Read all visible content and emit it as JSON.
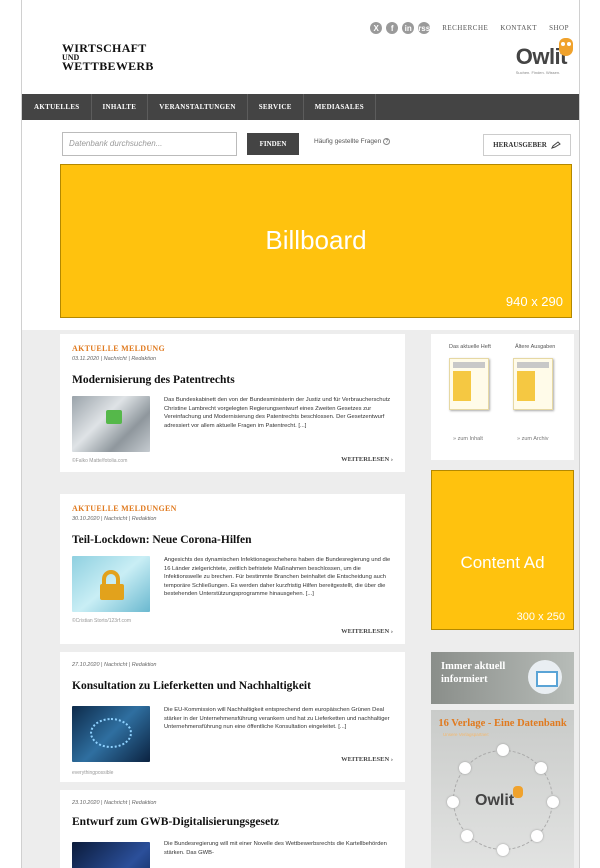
{
  "header": {
    "social_icons": [
      "X",
      "f",
      "in",
      "rss"
    ],
    "top_links": [
      "RECHERCHE",
      "KONTAKT",
      "SHOP"
    ],
    "logo": {
      "line1": "WIRTSCHAFT",
      "line2": "UND",
      "line3": "WETTBEWERB"
    },
    "owlit": {
      "name": "Owlit",
      "tagline": "Suchen. Finden. Wissen."
    }
  },
  "nav": {
    "items": [
      "AKTUELLES",
      "INHALTE",
      "VERANSTALTUNGEN",
      "SERVICE",
      "MEDIASALES"
    ]
  },
  "search": {
    "placeholder": "Datenbank durchsuchen...",
    "button": "FINDEN",
    "faq": "Häufig gestellte Fragen",
    "publisher_button": "HERAUSGEBER"
  },
  "billboard": {
    "label": "Billboard",
    "size": "940 x 290"
  },
  "articles": [
    {
      "kicker": "AKTUELLE MELDUNG",
      "meta": "03.11.2020 | Nachricht | Redaktion",
      "title": "Modernisierung des Patentrechts",
      "body": "Das Bundeskabinett den von der Bundesministerin der Justiz und für Verbraucherschutz Christine Lambrecht vorgelegten Regierungsentwurf eines Zweiten Gesetzes zur Vereinfachung und Modernisierung des Patentrechts beschlossen. Der Gesetzentwurf adressiert vor allem aktuelle Fragen im Patentrecht. [...]",
      "credit": "©Falko Matte/fotolia.com",
      "more": "WEITERLESEN"
    },
    {
      "kicker": "AKTUELLE MELDUNGEN",
      "meta": "30.10.2020 | Nachricht | Redaktion",
      "title": "Teil-Lockdown: Neue Corona-Hilfen",
      "body": "Angesichts des dynamischen Infektionsgeschehens haben die Bundesregierung und die 16 Länder zielgerichtete, zeitlich befristete Maßnahmen beschlossen, um die Infektionswelle zu brechen. Für bestimmte Branchen beinhaltet die Entscheidung auch temporäre Schließungen. Es werden daher kurzfristig Hilfen bereitgestellt, die über die bestehenden Unterstützungsprogramme hinausgehen. [...]",
      "credit": "©Cristian Storto/123rf.com",
      "more": "WEITERLESEN"
    },
    {
      "kicker": "",
      "meta": "27.10.2020 | Nachricht | Redaktion",
      "title": "Konsultation zu Lieferketten und Nachhaltigkeit",
      "body": "Die EU-Kommission will Nachhaltigkeit entsprechend dem europäischen Grünen Deal stärker in der Unternehmensführung verankern und hat zu Lieferketten und nachhaltiger Unternehmensführung nun eine öffentliche Konsultation eingeleitet. [...]",
      "credit": "everythingpossible",
      "more": "WEITERLESEN"
    },
    {
      "kicker": "",
      "meta": "23.10.2020 | Nachricht | Redaktion",
      "title": "Entwurf zum GWB-Digitalisierungsgesetz",
      "body": "Die Bundesregierung will mit einer Novelle des Wettbewerbsrechts die Kartellbehörden stärken. Das GWB-",
      "credit": "",
      "more": ""
    }
  ],
  "sidebar": {
    "current_issue": "Das aktuelle Heft",
    "older_issues": "Ältere Ausgaben",
    "to_content": "» zum Inhalt",
    "to_archive": "» zum Archiv",
    "content_ad": {
      "label": "Content Ad",
      "size": "300 x 250"
    },
    "newsletter": {
      "line1": "Immer aktuell",
      "line2": "informiert"
    },
    "verlage": {
      "title": "16 Verlage - Eine Datenbank",
      "subtitle": "Unsere Verlagspartner:",
      "logo": "Owlit"
    }
  },
  "colors": {
    "accent": "#e07a1f",
    "ad_yellow": "#ffc20e",
    "nav_bg": "#444444"
  }
}
